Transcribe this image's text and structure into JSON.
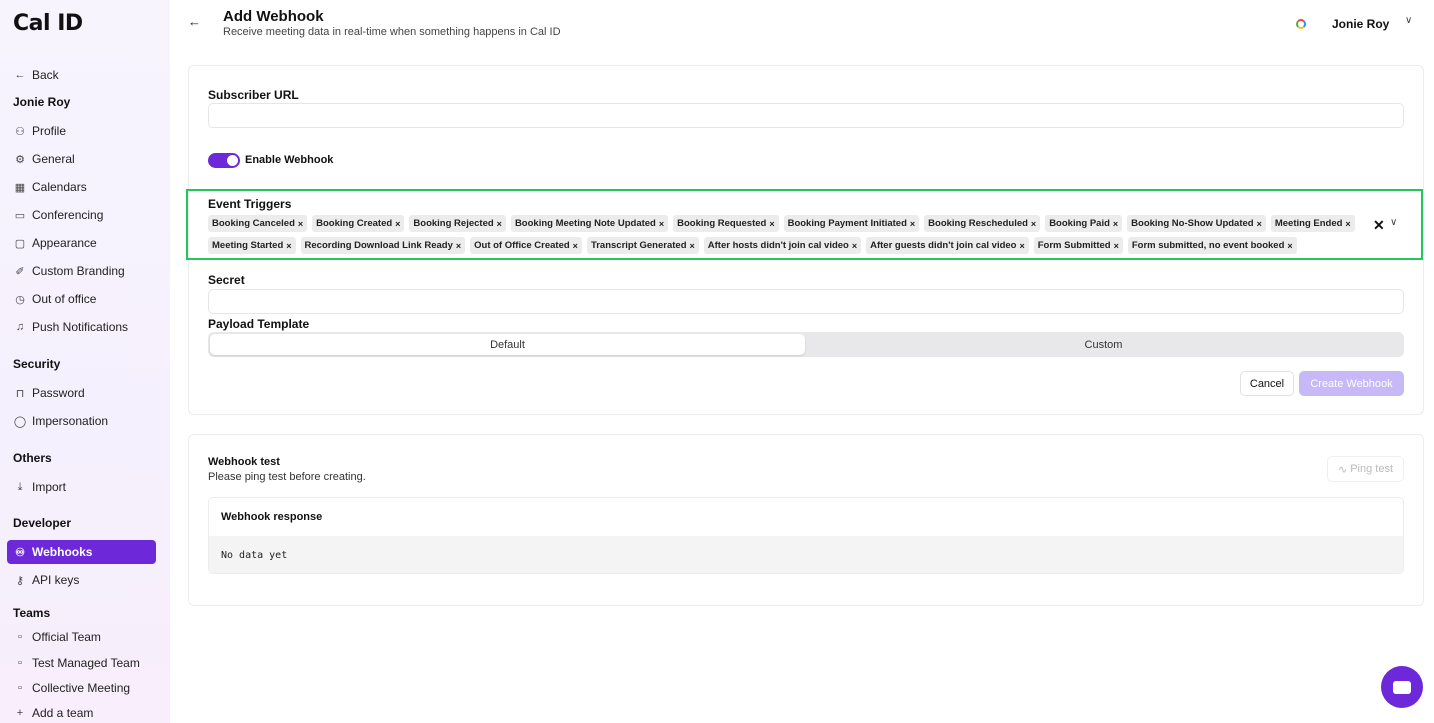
{
  "brand": {
    "logo": "Cal ID",
    "accent": "#6d28d9",
    "highlight": "#22c55e"
  },
  "sidebar": {
    "back_label": "Back",
    "user_heading": "Jonie Roy",
    "items": [
      {
        "label": "Profile",
        "icon": "user-icon"
      },
      {
        "label": "General",
        "icon": "gear-icon"
      },
      {
        "label": "Calendars",
        "icon": "calendar-icon"
      },
      {
        "label": "Conferencing",
        "icon": "video-icon"
      },
      {
        "label": "Appearance",
        "icon": "monitor-icon"
      },
      {
        "label": "Custom Branding",
        "icon": "brush-icon"
      },
      {
        "label": "Out of office",
        "icon": "clock-icon"
      },
      {
        "label": "Push Notifications",
        "icon": "bell-icon"
      }
    ],
    "security_heading": "Security",
    "security_items": [
      {
        "label": "Password",
        "icon": "lock-icon"
      },
      {
        "label": "Impersonation",
        "icon": "shield-icon"
      }
    ],
    "others_heading": "Others",
    "others_items": [
      {
        "label": "Import",
        "icon": "download-icon"
      }
    ],
    "developer_heading": "Developer",
    "developer_items": [
      {
        "label": "Webhooks",
        "icon": "webhook-icon",
        "active": true
      },
      {
        "label": "API keys",
        "icon": "key-icon"
      }
    ],
    "teams_heading": "Teams",
    "teams_items": [
      {
        "label": "Official Team",
        "icon": "team-icon"
      },
      {
        "label": "Test Managed Team",
        "icon": "team-icon"
      },
      {
        "label": "Collective Meeting",
        "icon": "team-icon"
      },
      {
        "label": "Add a team",
        "icon": "plus-icon"
      }
    ]
  },
  "header": {
    "title": "Add Webhook",
    "subtitle": "Receive meeting data in real-time when something happens in Cal ID",
    "user_name": "Jonie Roy"
  },
  "form": {
    "subscriber_url_label": "Subscriber URL",
    "subscriber_url_value": "",
    "enable_label": "Enable Webhook",
    "enabled": true,
    "event_triggers_label": "Event Triggers",
    "triggers": [
      "Booking Canceled",
      "Booking Created",
      "Booking Rejected",
      "Booking Meeting Note Updated",
      "Booking Requested",
      "Booking Payment Initiated",
      "Booking Rescheduled",
      "Booking Paid",
      "Booking No-Show Updated",
      "Meeting Ended",
      "Meeting Started",
      "Recording Download Link Ready",
      "Out of Office Created",
      "Transcript Generated",
      "After hosts didn't join cal video",
      "After guests didn't join cal video",
      "Form Submitted",
      "Form submitted, no event booked"
    ],
    "secret_label": "Secret",
    "secret_value": "",
    "payload_label": "Payload Template",
    "payload_options": [
      "Default",
      "Custom"
    ],
    "payload_selected": "Default",
    "cancel_label": "Cancel",
    "create_label": "Create Webhook"
  },
  "webhook_test": {
    "title": "Webhook test",
    "subtitle": "Please ping test before creating.",
    "ping_label": "Ping test",
    "response_title": "Webhook response",
    "response_body": "No data yet"
  }
}
